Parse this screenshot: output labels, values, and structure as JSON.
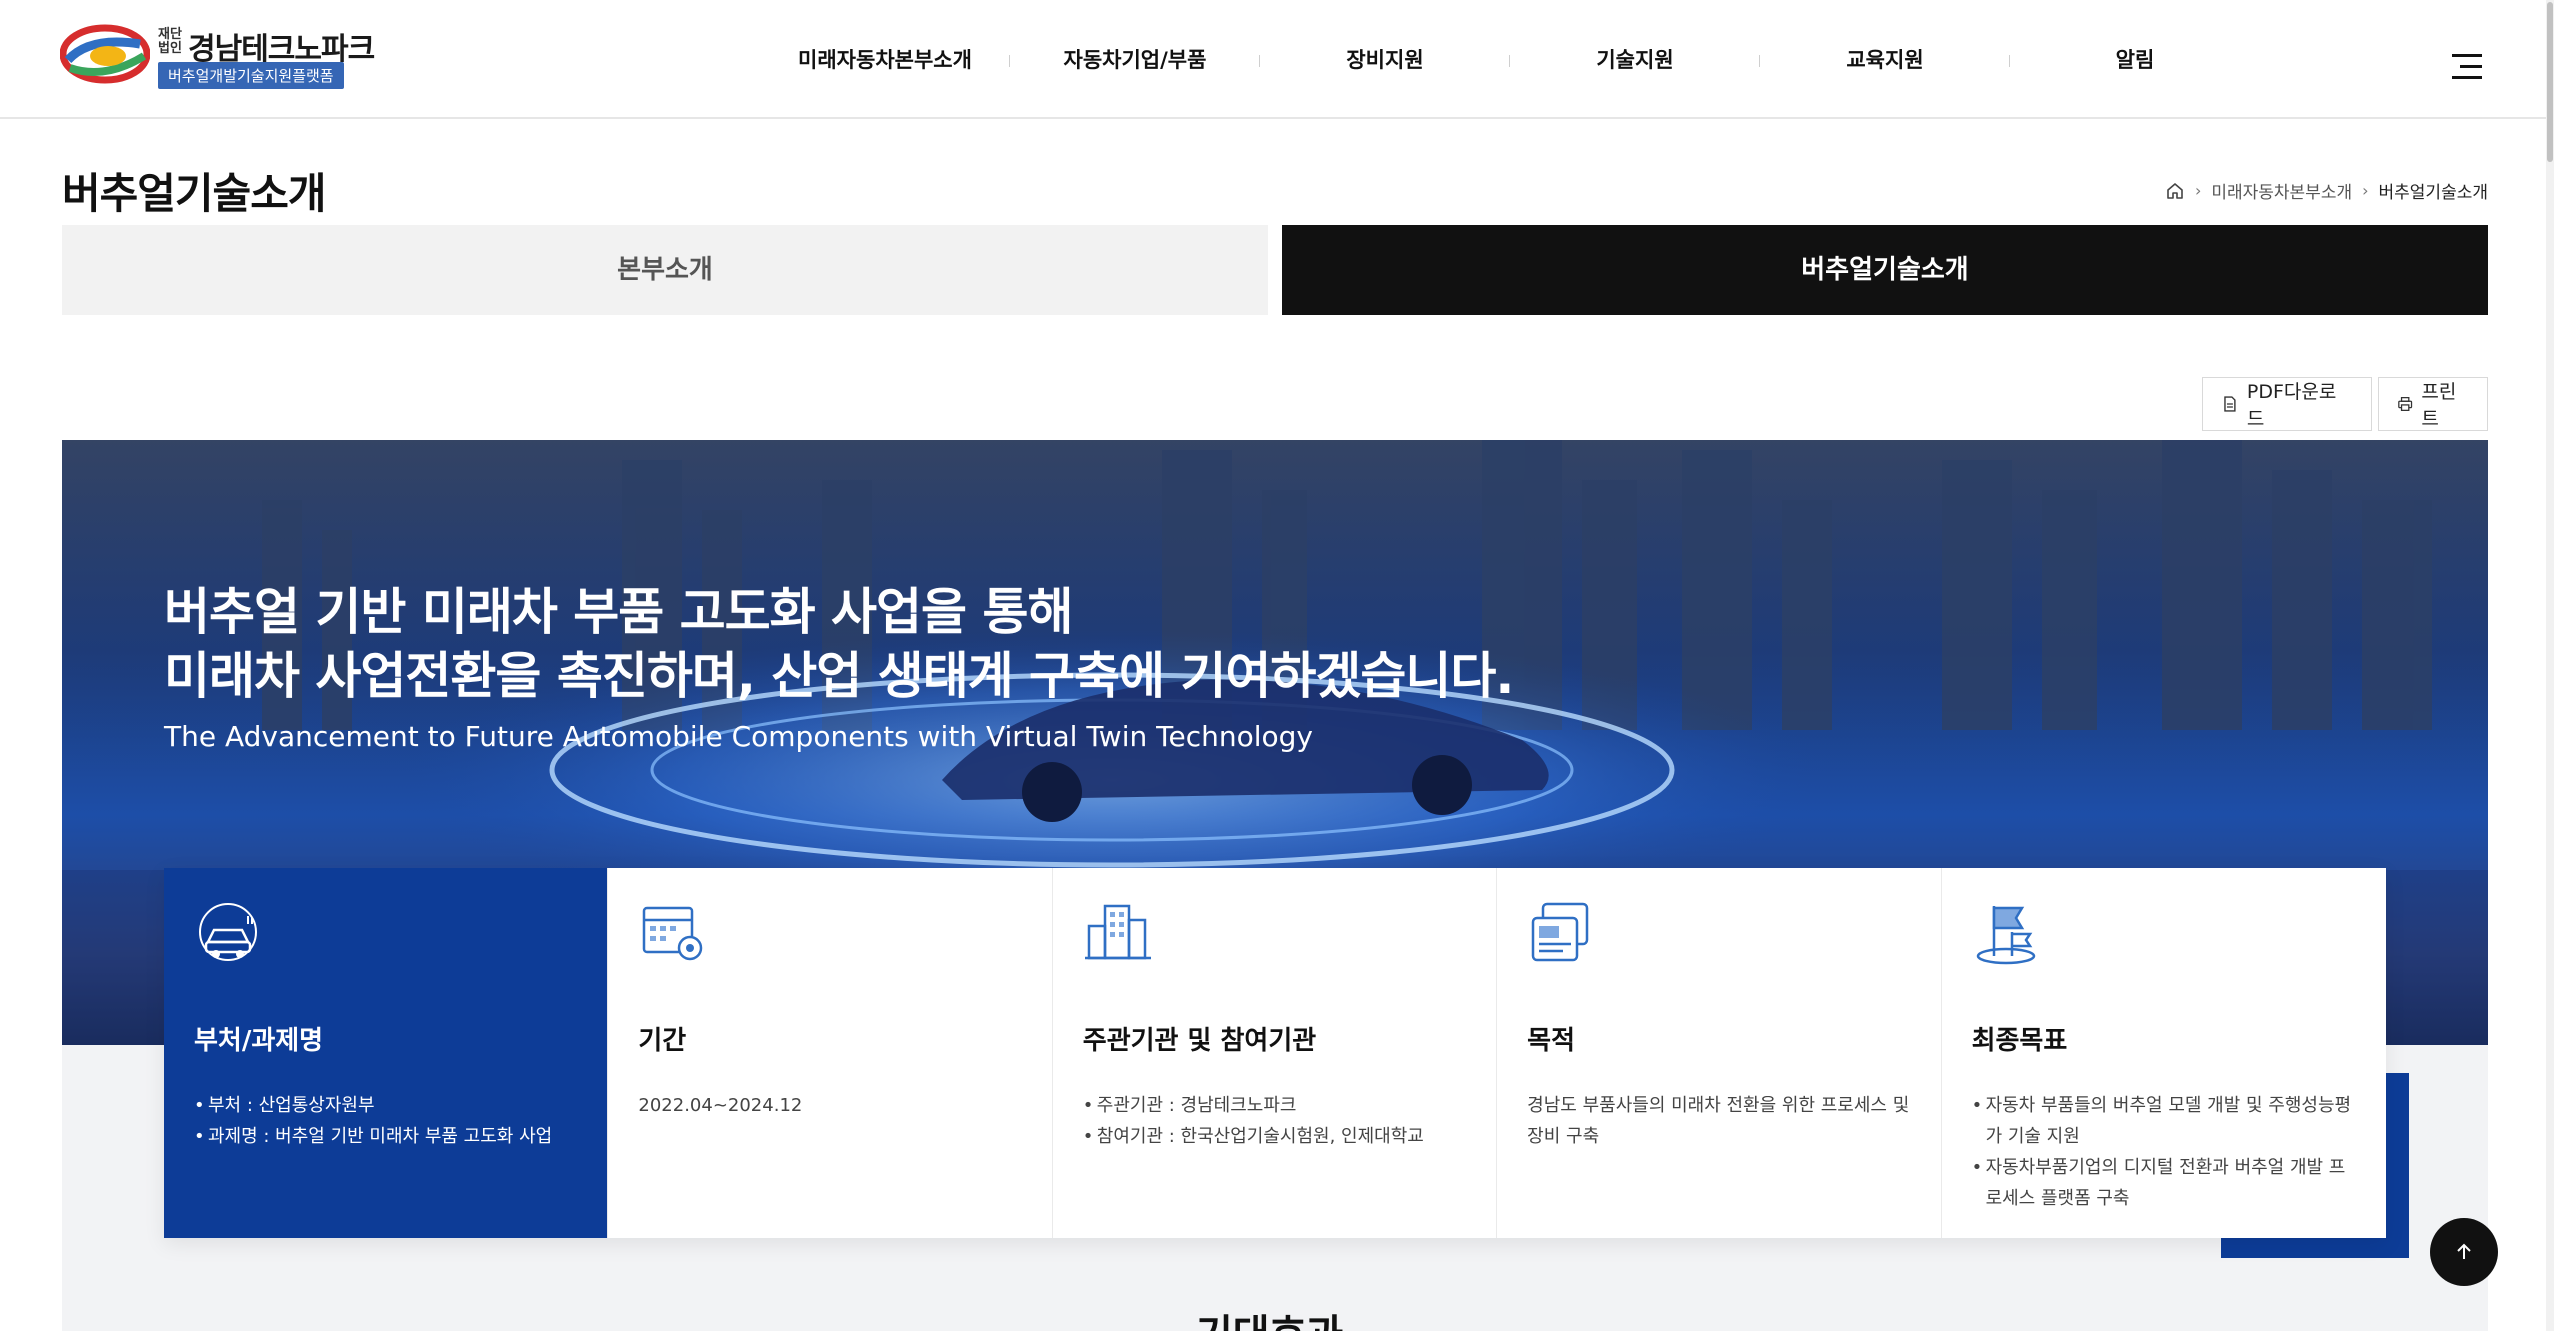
{
  "header": {
    "logo_small": "재단법인",
    "logo_name": "경남테크노파크",
    "logo_tag": "버추얼개발기술지원플랫폼",
    "nav": [
      "미래자동차본부소개",
      "자동차기업/부품",
      "장비지원",
      "기술지원",
      "교육지원",
      "알림"
    ]
  },
  "page": {
    "title": "버추얼기술소개",
    "breadcrumb": [
      "미래자동차본부소개",
      "버추얼기술소개"
    ]
  },
  "tabs": [
    {
      "label": "본부소개",
      "active": false
    },
    {
      "label": "버추얼기술소개",
      "active": true
    }
  ],
  "tools": {
    "pdf_label": "PDF다운로드",
    "print_label": "프린트"
  },
  "hero": {
    "headline_line1": "버추얼 기반 미래차 부품 고도화 사업을 통해",
    "headline_line2": "미래차 사업전환을 촉진하며, 산업 생태계 구축에 기여하겠습니다.",
    "subtitle": "The Advancement to Future Automobile Components with Virtual Twin Technology"
  },
  "cards": [
    {
      "icon": "car-icon",
      "title": "부처/과제명",
      "items": [
        "부처 : 산업통상자원부",
        "과제명 : 버추얼 기반 미래차 부품 고도화 사업"
      ],
      "active": true
    },
    {
      "icon": "calendar-gear-icon",
      "title": "기간",
      "text": "2022.04~2024.12",
      "active": false
    },
    {
      "icon": "building-icon",
      "title": "주관기관 및 참여기관",
      "items": [
        "주관기관 : 경남테크노파크",
        "참여기관 : 한국산업기술시험원, 인제대학교"
      ],
      "active": false
    },
    {
      "icon": "documents-icon",
      "title": "목적",
      "text": "경남도 부품사들의 미래차 전환을 위한 프로세스 및 장비 구축",
      "active": false
    },
    {
      "icon": "flag-target-icon",
      "title": "최종목표",
      "items": [
        "자동차 부품들의 버추얼 모델 개발 및 주행성능평가 기술 지원",
        "자동차부품기업의 디지털 전환과 버추얼 개발 프로세스 플랫폼 구축"
      ],
      "active": false
    }
  ],
  "next_section_heading": "기대효과",
  "colors": {
    "brand_blue": "#0d3c97",
    "logo_tag_blue": "#3566b5",
    "active_tab": "#111111"
  }
}
